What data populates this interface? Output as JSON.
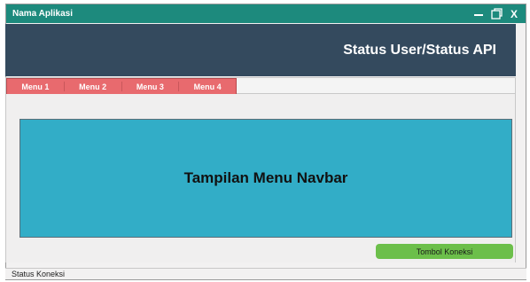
{
  "window": {
    "title": "Nama Aplikasi",
    "controls": {
      "minimize_icon": "minimize-icon",
      "maximize_icon": "maximize-icon",
      "close_label": "X"
    }
  },
  "header": {
    "status": "Status User/Status API"
  },
  "navbar": {
    "items": [
      {
        "label": "Menu 1"
      },
      {
        "label": "Menu 2"
      },
      {
        "label": "Menu 3"
      },
      {
        "label": "Menu 4"
      }
    ]
  },
  "main": {
    "display_text": "Tampilan Menu Navbar",
    "connect_button_label": "Tombol Koneksi"
  },
  "statusbar": {
    "text": "Status Koneksi"
  },
  "colors": {
    "titlebar": "#1d8a7d",
    "header": "#344a5e",
    "menu": "#e86a6e",
    "panel": "#32adc7",
    "button": "#6cbf4a"
  }
}
